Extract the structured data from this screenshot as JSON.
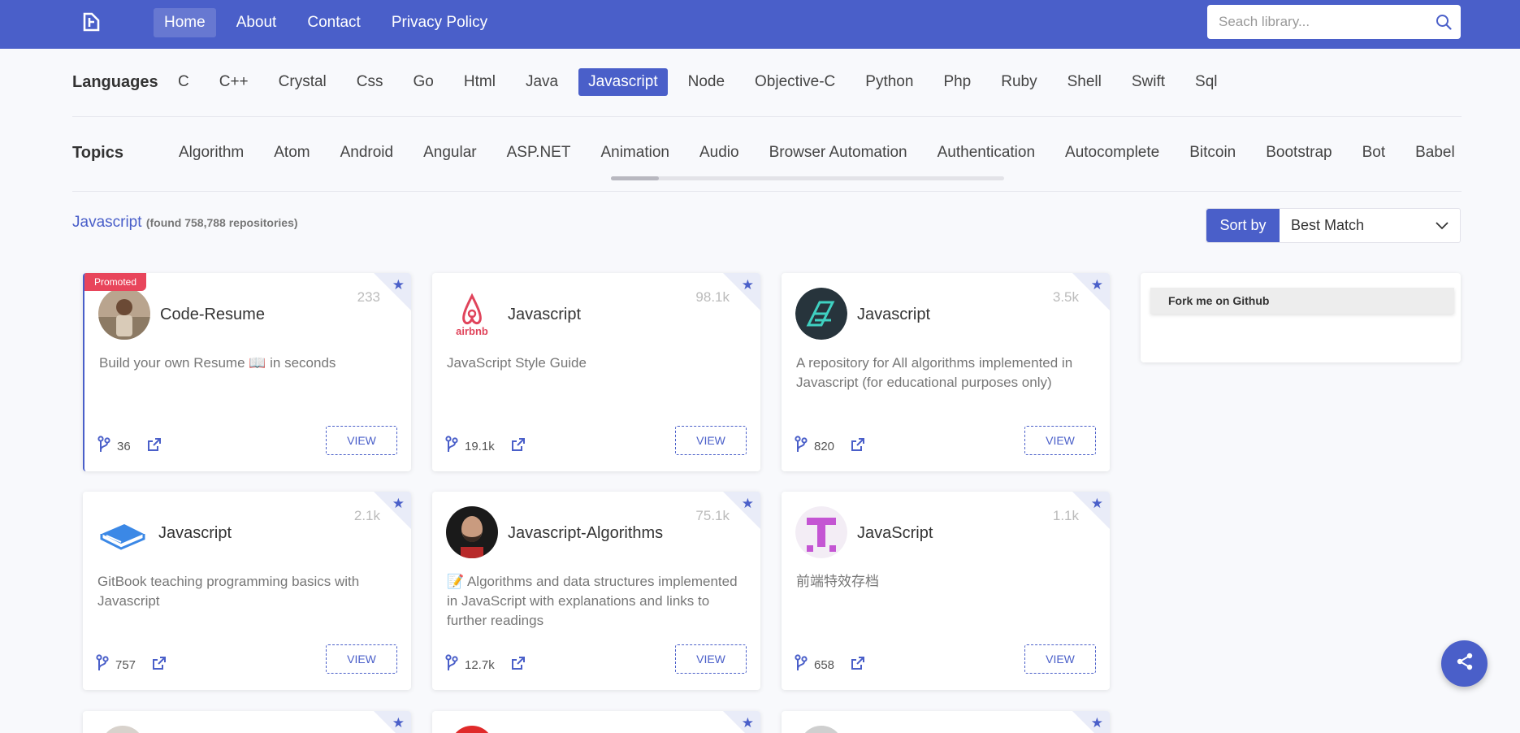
{
  "nav": {
    "links": [
      "Home",
      "About",
      "Contact",
      "Privacy Policy"
    ],
    "active": "Home",
    "search_placeholder": "Seach library..."
  },
  "languages": {
    "label": "Languages",
    "items": [
      "C",
      "C++",
      "Crystal",
      "Css",
      "Go",
      "Html",
      "Java",
      "Javascript",
      "Node",
      "Objective-C",
      "Python",
      "Php",
      "Ruby",
      "Shell",
      "Swift",
      "Sql"
    ],
    "active": "Javascript"
  },
  "topics": {
    "label": "Topics",
    "items": [
      "Algorithm",
      "Atom",
      "Android",
      "Angular",
      "ASP.NET",
      "Animation",
      "Audio",
      "Browser Automation",
      "Authentication",
      "Autocomplete",
      "Bitcoin",
      "Bootstrap",
      "Bot",
      "Babel"
    ]
  },
  "results": {
    "title": "Javascript",
    "count_text": "(found 758,788 repositories)"
  },
  "sort": {
    "label": "Sort by",
    "value": "Best Match"
  },
  "cards": [
    {
      "title": "Code-Resume",
      "stars": "233",
      "desc": "Build your own Resume 📖 in seconds",
      "forks": "36",
      "view": "VIEW",
      "promoted": "Promoted",
      "avatar": "photo-man"
    },
    {
      "title": "Javascript",
      "stars": "98.1k",
      "desc": "JavaScript Style Guide",
      "forks": "19.1k",
      "view": "VIEW",
      "avatar": "airbnb-logo"
    },
    {
      "title": "Javascript",
      "stars": "3.5k",
      "desc": "A repository for All algorithms implemented in Javascript (for educational purposes only)",
      "forks": "820",
      "view": "VIEW",
      "avatar": "algorithms-logo"
    },
    {
      "title": "Javascript",
      "stars": "2.1k",
      "desc": "GitBook teaching programming basics with Javascript",
      "forks": "757",
      "view": "VIEW",
      "avatar": "book-logo"
    },
    {
      "title": "Javascript-Algorithms",
      "stars": "75.1k",
      "desc": "📝 Algorithms and data structures implemented in JavaScript with explanations and links to further readings",
      "forks": "12.7k",
      "view": "VIEW",
      "avatar": "photo-bearded-man"
    },
    {
      "title": "JavaScript",
      "stars": "1.1k",
      "desc": "前端特效存档",
      "forks": "658",
      "view": "VIEW",
      "avatar": "t-logo"
    }
  ],
  "sidebar": {
    "fork_label": "Fork me on Github"
  },
  "colors": {
    "primary": "#4a5fc9",
    "promoted": "#e8455b"
  }
}
